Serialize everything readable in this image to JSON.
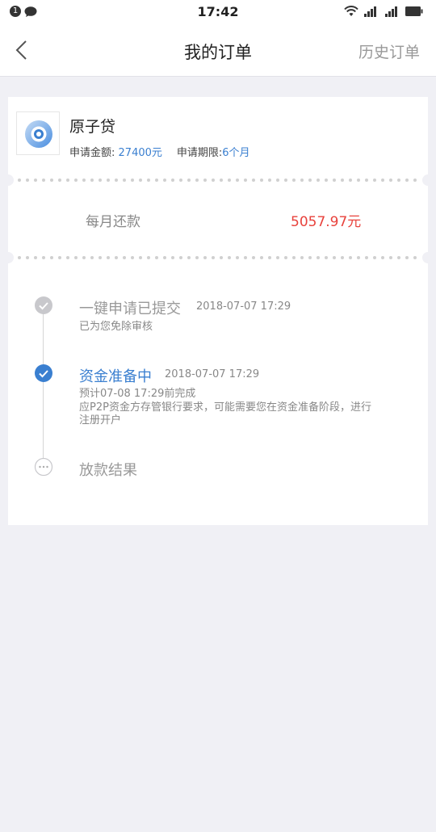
{
  "status_bar": {
    "notification_count": "1",
    "time": "17:42"
  },
  "header": {
    "title": "我的订单",
    "history_label": "历史订单"
  },
  "order": {
    "product_name": "原子贷",
    "amount_label": "申请金额:",
    "amount_value": "27400元",
    "term_label": "申请期限:",
    "term_value": "6个月",
    "monthly_label": "每月还款",
    "monthly_value": "5057.97元"
  },
  "timeline": [
    {
      "title": "一键申请已提交",
      "time": "2018-07-07 17:29",
      "desc": "已为您免除审核",
      "state": "done"
    },
    {
      "title": "资金准备中",
      "time": "2018-07-07 17:29",
      "desc_line1": "预计07-08 17:29前完成",
      "desc_line2": "应P2P资金方存管银行要求，可能需要您在资金准备阶段，进行注册开户",
      "state": "active"
    },
    {
      "title": "放款结果",
      "state": "pending"
    }
  ],
  "colors": {
    "accent": "#3a7fd0",
    "amount_red": "#e8423c",
    "background": "#f0f0f5"
  }
}
